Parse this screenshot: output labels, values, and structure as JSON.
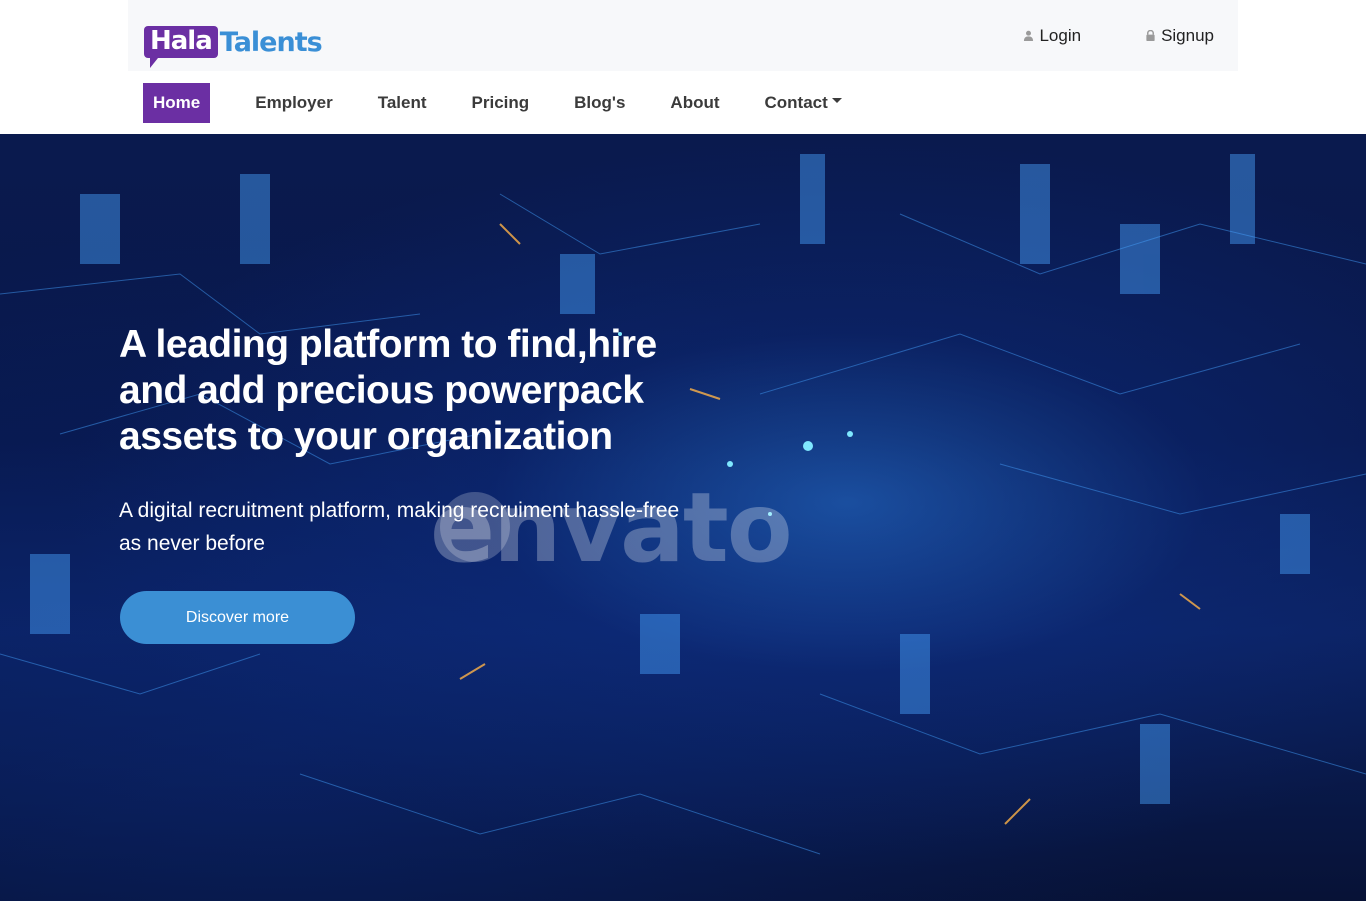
{
  "brand": {
    "logo_part1": "Hala",
    "logo_part2": "Talents"
  },
  "auth": {
    "login_label": "Login",
    "signup_label": "Signup"
  },
  "nav": {
    "items": [
      {
        "label": "Home"
      },
      {
        "label": "Employer"
      },
      {
        "label": "Talent"
      },
      {
        "label": "Pricing"
      },
      {
        "label": "Blog's"
      },
      {
        "label": "About"
      },
      {
        "label": "Contact"
      }
    ]
  },
  "hero": {
    "title": "A leading platform to find,hire and add precious powerpack assets to your organization",
    "subtitle": "A digital recruitment platform, making recruiment hassle-free as never before",
    "cta_label": "Discover more",
    "watermark": "envato"
  },
  "colors": {
    "brand_purple": "#6b2fa3",
    "brand_blue": "#3a8fd6",
    "button_blue": "#3b8fd4",
    "hero_dark": "#0a1a4e"
  },
  "icons": {
    "login": "user-icon",
    "signup": "lock-icon",
    "contact_dropdown": "caret-down-icon"
  }
}
